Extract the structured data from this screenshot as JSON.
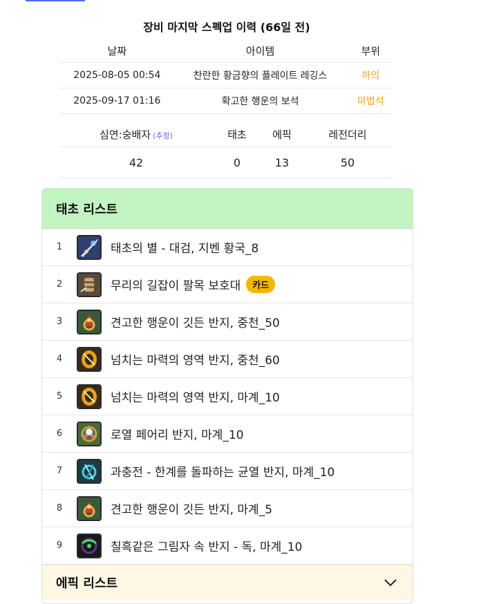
{
  "history": {
    "title": "장비 마지막 스펙업 이력 (66일 전)",
    "headers": {
      "date": "날짜",
      "item": "아이템",
      "part": "부위"
    },
    "rows": [
      {
        "date": "2025-08-05 00:54",
        "item": "찬란한 황금향의 플레이트 레깅스",
        "part": "하의",
        "part_color": "#f0a21b"
      },
      {
        "date": "2025-09-17 01:16",
        "item": "확고한 행운의 보석",
        "part": "마법석",
        "part_color": "#f0a21b"
      }
    ]
  },
  "stats": {
    "headers": {
      "mode": "심연:숭배자",
      "estimate": "(추정)",
      "primeval": "태초",
      "epic": "에픽",
      "legendary": "레전더리"
    },
    "values": {
      "mode": "42",
      "primeval": "0",
      "epic": "13",
      "legendary": "50"
    }
  },
  "primeval_list": {
    "title": "태초 리스트",
    "items": [
      {
        "num": "1",
        "name": "태초의 별 - 대검, 지벤 황국_8",
        "icon": "greatsword-icon"
      },
      {
        "num": "2",
        "name": "무리의 길잡이 팔목 보호대",
        "icon": "bracer-icon",
        "badge": "카드"
      },
      {
        "num": "3",
        "name": "견고한 행운이 깃든 반지, 중천_50",
        "icon": "ring-icon"
      },
      {
        "num": "4",
        "name": "넘치는 마력의 영역 반지, 중천_60",
        "icon": "ring-icon"
      },
      {
        "num": "5",
        "name": "넘치는 마력의 영역 반지, 마계_10",
        "icon": "ring-icon"
      },
      {
        "num": "6",
        "name": "로열 페어리 반지, 마계_10",
        "icon": "ring-icon"
      },
      {
        "num": "7",
        "name": "과충전 - 한계를 돌파하는 균열 반지, 마계_10",
        "icon": "ring-icon"
      },
      {
        "num": "8",
        "name": "견고한 행운이 깃든 반지, 마계_5",
        "icon": "ring-icon"
      },
      {
        "num": "9",
        "name": "칠흑같은 그림자 속 반지 - 독, 마계_10",
        "icon": "ring-icon"
      }
    ]
  },
  "epic_list": {
    "title": "에픽 리스트",
    "icon": "chevron-down-icon"
  },
  "colors": {
    "primeval_header": "#c2f4c2",
    "epic_header": "#fdf7e3",
    "badge": "#f5b800",
    "part_text": "#f0a21b",
    "estimate_text": "#6d5ee6"
  }
}
